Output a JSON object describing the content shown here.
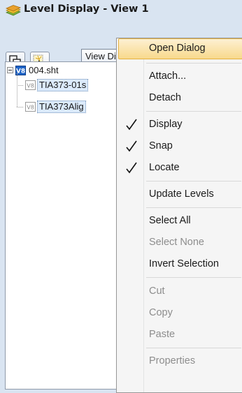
{
  "window": {
    "title": "Level Display - View 1",
    "title_icon": "level-display-icon"
  },
  "toolbar": {
    "combo_value": "View Display",
    "buttons": [
      "copy-levels-icon",
      "select-pointer-icon",
      "layers-icon"
    ]
  },
  "tree": {
    "root": {
      "label": "004.sht",
      "icon": "v8-model-icon"
    },
    "children": [
      {
        "label": "TIA373-01s",
        "icon": "v8-reference-icon"
      },
      {
        "label": "TIA373Alig",
        "icon": "v8-reference-icon"
      }
    ]
  },
  "menu": {
    "items": [
      {
        "label": "Open Dialog",
        "enabled": true,
        "highlighted": true,
        "checked": false
      },
      {
        "label": "Attach...",
        "enabled": true,
        "checked": false
      },
      {
        "label": "Detach",
        "enabled": true,
        "checked": false
      },
      {
        "label": "Display",
        "enabled": true,
        "checked": true
      },
      {
        "label": "Snap",
        "enabled": true,
        "checked": true
      },
      {
        "label": "Locate",
        "enabled": true,
        "checked": true
      },
      {
        "label": "Update Levels",
        "enabled": true,
        "checked": false
      },
      {
        "label": "Select All",
        "enabled": true,
        "checked": false
      },
      {
        "label": "Select None",
        "enabled": false,
        "checked": false
      },
      {
        "label": "Invert Selection",
        "enabled": true,
        "checked": false
      },
      {
        "label": "Cut",
        "enabled": false,
        "checked": false
      },
      {
        "label": "Copy",
        "enabled": false,
        "checked": false
      },
      {
        "label": "Paste",
        "enabled": false,
        "checked": false
      },
      {
        "label": "Properties",
        "enabled": false,
        "checked": false
      }
    ]
  },
  "colors": {
    "highlight": "#f8d98c",
    "selection": "#dbeafb",
    "disabled_text": "#8d8d8d",
    "frame": "#d9e4f1"
  }
}
